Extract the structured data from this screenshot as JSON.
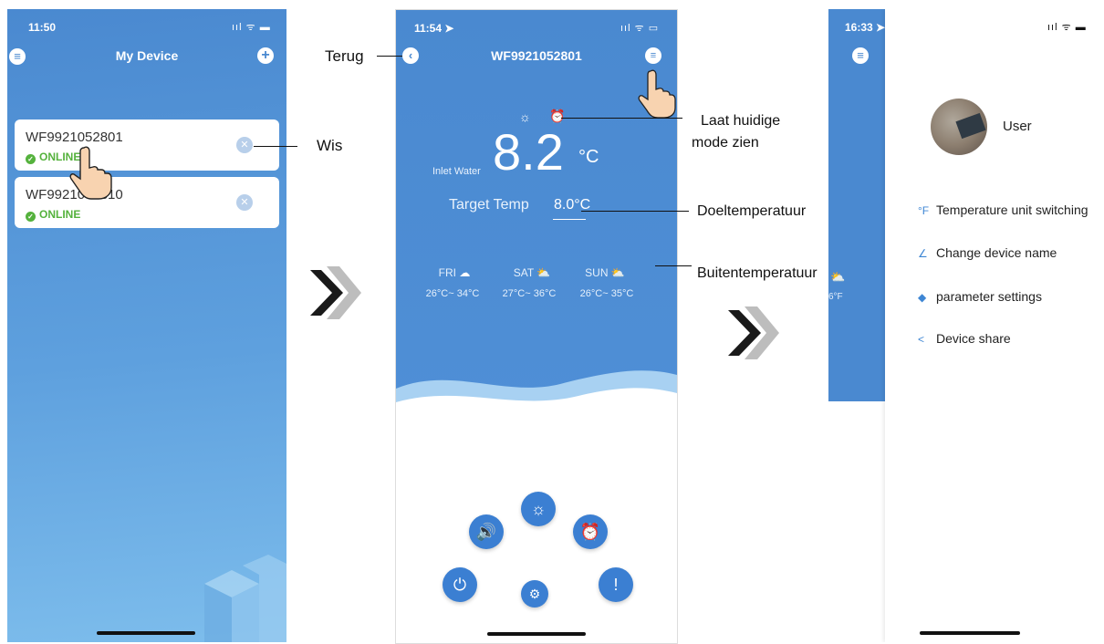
{
  "screen1": {
    "time": "11:50",
    "title": "My Device",
    "devices": [
      {
        "id": "WF9921052801",
        "status": "ONLINE"
      },
      {
        "id": "WF9921052810",
        "status": "ONLINE"
      }
    ]
  },
  "screen2": {
    "time": "11:54",
    "title": "WF9921052801",
    "inlet_label": "Inlet Water",
    "temperature": "8.2",
    "unit": "°C",
    "target_label": "Target Temp",
    "target_value": "8.0°C",
    "forecast": [
      {
        "day": "FRI",
        "range": "26°C~ 34°C"
      },
      {
        "day": "SAT",
        "range": "27°C~ 36°C"
      },
      {
        "day": "SUN",
        "range": "26°C~ 35°C"
      }
    ]
  },
  "screen3": {
    "time": "16:33",
    "user": "User",
    "peek_text": "6°F",
    "menu": [
      {
        "label": "Temperature unit switching",
        "icon": "°F"
      },
      {
        "label": "Change device name",
        "icon": "∠"
      },
      {
        "label": "parameter settings",
        "icon": "◆"
      },
      {
        "label": "Device share",
        "icon": "<"
      }
    ]
  },
  "annotations": {
    "back": "Terug",
    "delete": "Wis",
    "mode_line1": "Laat huidige",
    "mode_line2": "mode zien",
    "target": "Doeltemperatuur",
    "outside": "Buitentemperatuur"
  },
  "colors": {
    "blue_top": "#4a89d0",
    "blue_light": "#78b6ea",
    "online_green": "#55b23d",
    "fab_blue": "#3b7fd2"
  },
  "icons": [
    "menu-icon",
    "plus-icon",
    "back-icon",
    "list-icon",
    "sun-icon",
    "alarm-icon",
    "cloud-rain-icon",
    "partly-sunny-icon",
    "volume-icon",
    "power-icon",
    "settings-icon",
    "alert-icon",
    "share-icon",
    "edit-icon",
    "thermometer-icon",
    "chevron-arrow-icon"
  ]
}
